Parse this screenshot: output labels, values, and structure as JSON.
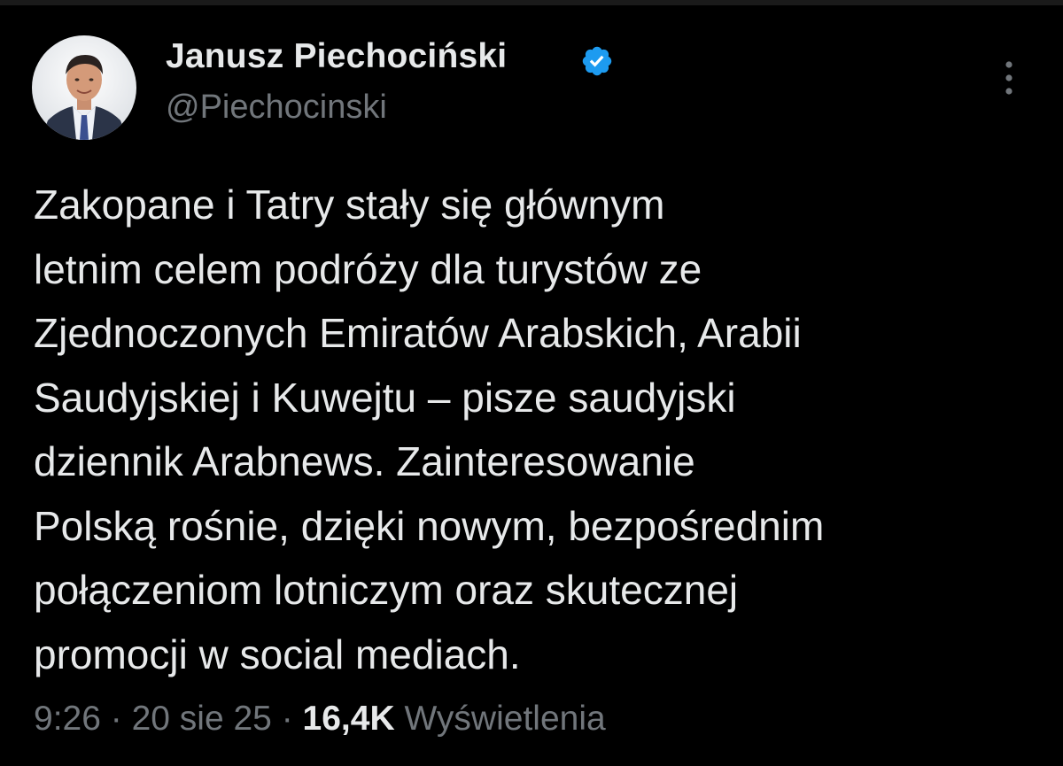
{
  "author": {
    "display_name": "Janusz Piechociński",
    "handle": "@Piechocinski",
    "verified": true,
    "avatar_icon": "user-photo-avatar"
  },
  "tweet": {
    "lines": [
      "Zakopane i Tatry stały się głównym",
      "letnim celem podróży dla turystów ze",
      "Zjednoczonych Emiratów Arabskich, Arabii",
      "Saudyjskiej i Kuwejtu – pisze saudyjski",
      "dziennik Arabnews. Zainteresowanie",
      "Polską rośnie, dzięki nowym, bezpośrednim",
      "połączeniom lotniczym oraz skutecznej",
      "promocji w social mediach."
    ]
  },
  "meta": {
    "time": "9:26",
    "separator": " · ",
    "date": "20 sie 25",
    "views_count": "16,4K",
    "views_label": "Wyświetlenia"
  },
  "icons": {
    "verified": "verified-badge-icon",
    "more": "more-options-icon"
  },
  "colors": {
    "background": "#000000",
    "text_primary": "#e7e9ea",
    "text_secondary": "#71767b",
    "verified_blue": "#1d9bf0"
  }
}
